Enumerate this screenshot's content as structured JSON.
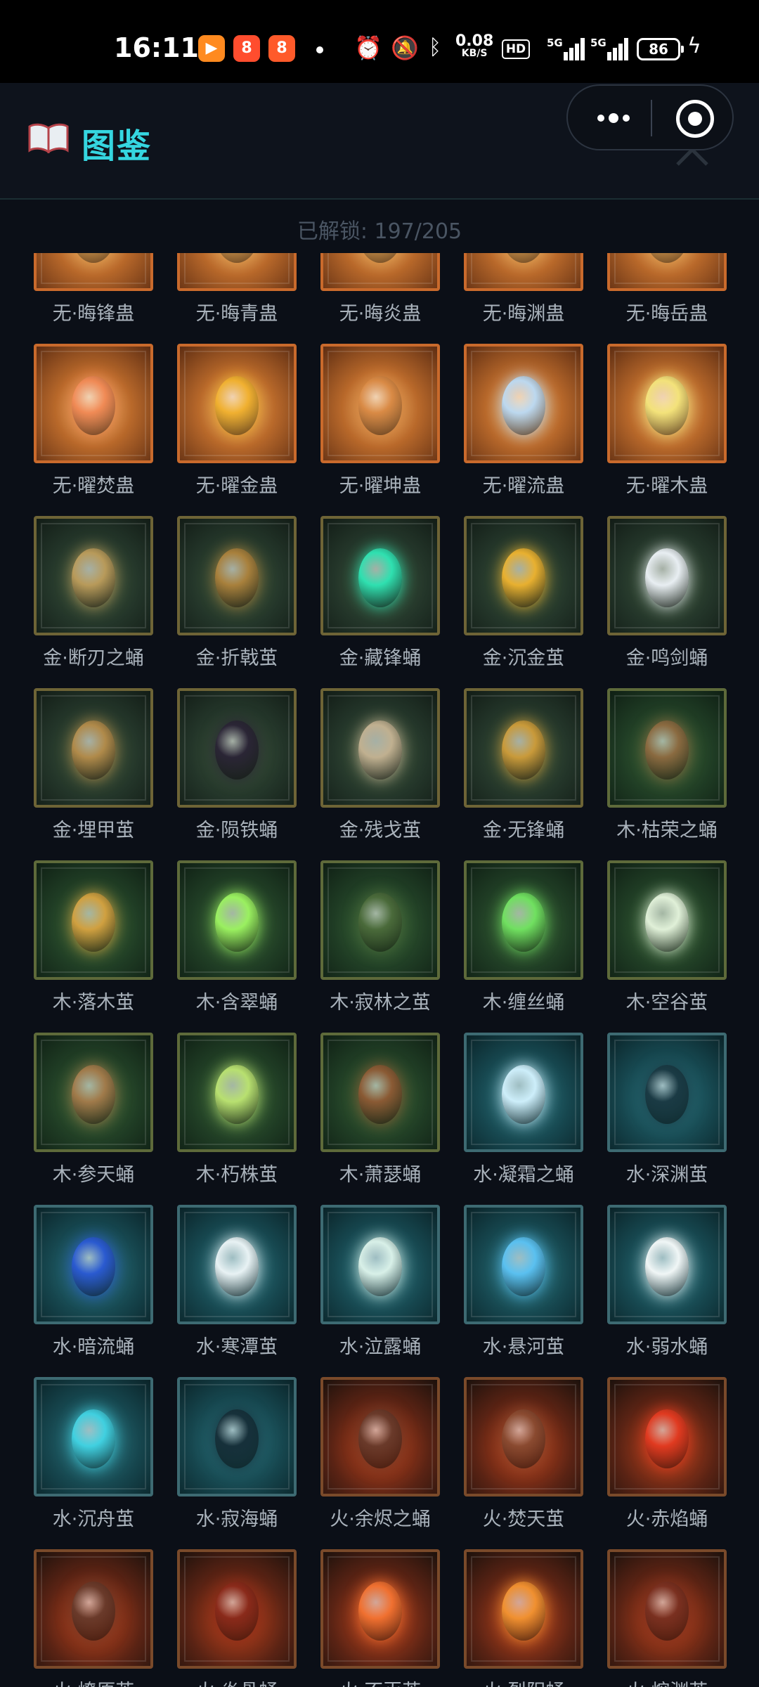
{
  "status_bar": {
    "time": "16:11",
    "apps": [
      {
        "icon": "video-app-icon",
        "glyph": "▶",
        "color": "#ff8a1f"
      },
      {
        "icon": "game-app-icon",
        "glyph": "8",
        "color": "#ff4d2e"
      },
      {
        "icon": "game-app-icon-2",
        "glyph": "8",
        "color": "#ff5a2a"
      }
    ],
    "speed_value": "0.08",
    "speed_unit": "KB/S",
    "hd_label": "HD",
    "network_1": "5G",
    "network_2": "5G",
    "battery": "86"
  },
  "header": {
    "title": "图鉴"
  },
  "unlocked_text": "已解锁: 197/205",
  "colors": {
    "accent": "#35d6e0",
    "background": "#0b0f17"
  },
  "items": [
    {
      "name": "无·晦锋蛊",
      "element": "earth",
      "egg_color": "#e0a050"
    },
    {
      "name": "无·晦青蛊",
      "element": "earth",
      "egg_color": "#e0a050"
    },
    {
      "name": "无·晦炎蛊",
      "element": "earth",
      "egg_color": "#e0a050"
    },
    {
      "name": "无·晦渊蛊",
      "element": "earth",
      "egg_color": "#e0a050"
    },
    {
      "name": "无·晦岳蛊",
      "element": "earth",
      "egg_color": "#e0a050"
    },
    {
      "name": "无·曜焚蛊",
      "element": "earth",
      "egg_color": "#f08a55"
    },
    {
      "name": "无·曜金蛊",
      "element": "earth",
      "egg_color": "#f0b030"
    },
    {
      "name": "无·曜坤蛊",
      "element": "earth",
      "egg_color": "#d98a45"
    },
    {
      "name": "无·曜流蛊",
      "element": "earth",
      "egg_color": "#bcd8ef"
    },
    {
      "name": "无·曜木蛊",
      "element": "earth",
      "egg_color": "#f3e27a"
    },
    {
      "name": "金·断刃之蛹",
      "element": "gold",
      "egg_color": "#b89a5a"
    },
    {
      "name": "金·折戟茧",
      "element": "gold",
      "egg_color": "#a8803c"
    },
    {
      "name": "金·藏锋蛹",
      "element": "gold",
      "egg_color": "#2fe0b0"
    },
    {
      "name": "金·沉金茧",
      "element": "gold",
      "egg_color": "#e8b030"
    },
    {
      "name": "金·鸣剑蛹",
      "element": "gold",
      "egg_color": "#e8eef2"
    },
    {
      "name": "金·埋甲茧",
      "element": "gold",
      "egg_color": "#b08a4a"
    },
    {
      "name": "金·陨铁蛹",
      "element": "gold",
      "egg_color": "#2a2535"
    },
    {
      "name": "金·残戈茧",
      "element": "gold",
      "egg_color": "#c0b090"
    },
    {
      "name": "金·无锋蛹",
      "element": "gold",
      "egg_color": "#c99a3a"
    },
    {
      "name": "木·枯荣之蛹",
      "element": "wood",
      "egg_color": "#8a6a40"
    },
    {
      "name": "木·落木茧",
      "element": "wood",
      "egg_color": "#d0a040"
    },
    {
      "name": "木·含翠蛹",
      "element": "wood",
      "egg_color": "#9af060"
    },
    {
      "name": "木·寂林之茧",
      "element": "wood",
      "egg_color": "#4a6a3a"
    },
    {
      "name": "木·缠丝蛹",
      "element": "wood",
      "egg_color": "#70e060"
    },
    {
      "name": "木·空谷茧",
      "element": "wood",
      "egg_color": "#e0f0d8"
    },
    {
      "name": "木·参天蛹",
      "element": "wood",
      "egg_color": "#a07a4a"
    },
    {
      "name": "木·朽株茧",
      "element": "wood",
      "egg_color": "#b8e070"
    },
    {
      "name": "木·萧瑟蛹",
      "element": "wood",
      "egg_color": "#8a5a34"
    },
    {
      "name": "水·凝霜之蛹",
      "element": "water",
      "egg_color": "#cdeefa"
    },
    {
      "name": "水·深渊茧",
      "element": "water",
      "egg_color": "#1a3a44"
    },
    {
      "name": "水·暗流蛹",
      "element": "water",
      "egg_color": "#2a5ad0"
    },
    {
      "name": "水·寒潭茧",
      "element": "water",
      "egg_color": "#e8f2f4"
    },
    {
      "name": "水·泣露蛹",
      "element": "water",
      "egg_color": "#d8f0e8"
    },
    {
      "name": "水·悬河茧",
      "element": "water",
      "egg_color": "#5ac0f0"
    },
    {
      "name": "水·弱水蛹",
      "element": "water",
      "egg_color": "#f0f6f6"
    },
    {
      "name": "水·沉舟茧",
      "element": "water",
      "egg_color": "#40d0e0"
    },
    {
      "name": "水·寂海蛹",
      "element": "water",
      "egg_color": "#16303a"
    },
    {
      "name": "火·余烬之蛹",
      "element": "fire",
      "egg_color": "#6a3a2a"
    },
    {
      "name": "火·焚天茧",
      "element": "fire",
      "egg_color": "#8a4a30"
    },
    {
      "name": "火·赤焰蛹",
      "element": "fire",
      "egg_color": "#e03a20"
    },
    {
      "name": "火·燎原茧",
      "element": "fire",
      "egg_color": "#6a3a2a"
    },
    {
      "name": "火·炎骨蛹",
      "element": "fire",
      "egg_color": "#8a2a1a"
    },
    {
      "name": "火·不灭茧",
      "element": "fire",
      "egg_color": "#f07030"
    },
    {
      "name": "火·烈阳蛹",
      "element": "fire",
      "egg_color": "#f09030"
    },
    {
      "name": "火·熔渊茧",
      "element": "fire",
      "egg_color": "#7a3020"
    }
  ]
}
